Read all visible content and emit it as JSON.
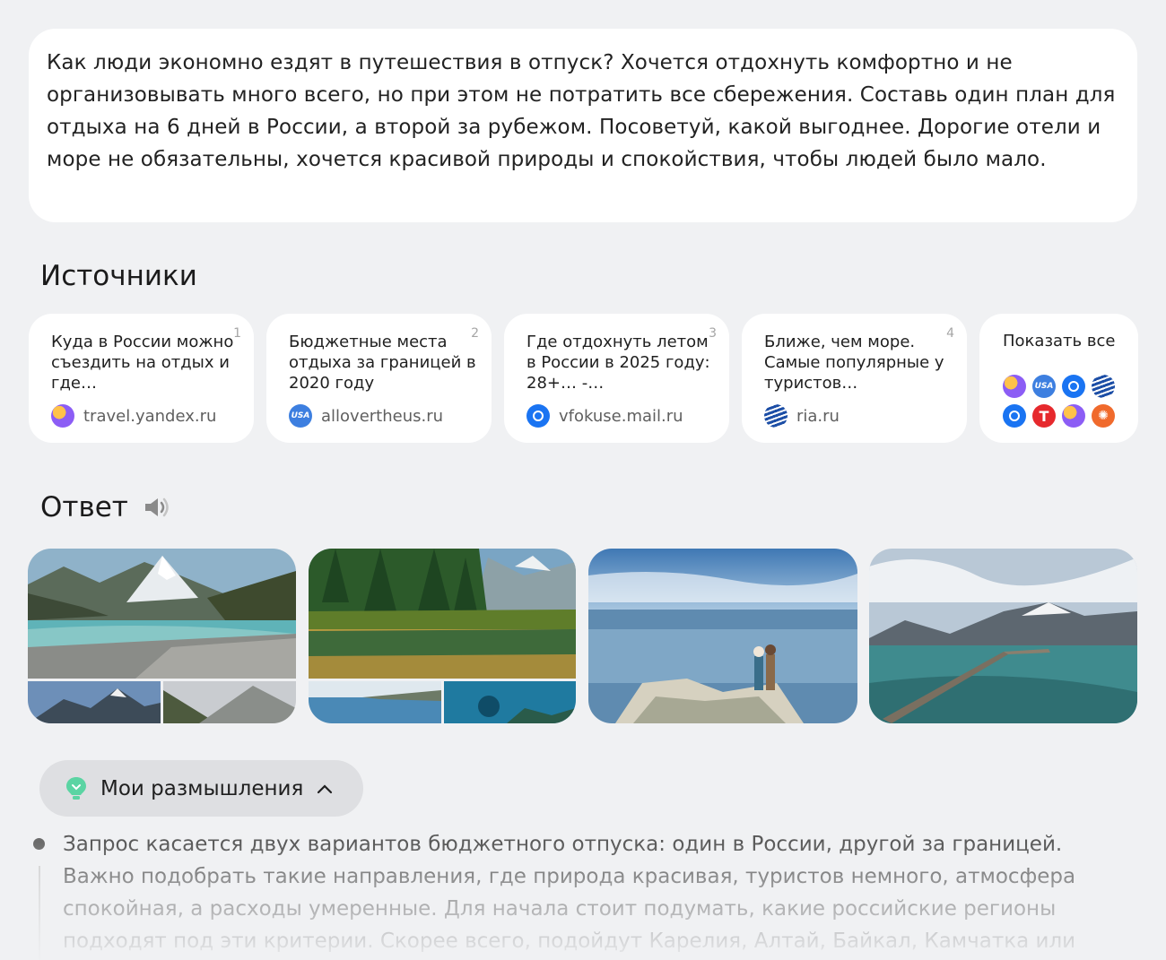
{
  "query": {
    "text": "Как люди экономно ездят в путешествия в отпуск? Хочется отдохнуть комфортно и не организовывать много всего, но при этом не потратить все сбережения. Составь один план для отдыха на 6 дней в России, а второй за рубежом. Посоветуй, какой выгоднее. Дорогие отели и море не обязательны, хочется красивой природы и спокойствия, чтобы людей было мало."
  },
  "sources": {
    "title": "Источники",
    "items": [
      {
        "num": "1",
        "title": "Куда в России можно съездить на отдых и где…",
        "domain": "travel.yandex.ru",
        "favicon": "yandex-travel-icon"
      },
      {
        "num": "2",
        "title": "Бюджетные места отдыха за границей в 2020 году",
        "domain": "allovertheus.ru",
        "favicon": "usa-icon"
      },
      {
        "num": "3",
        "title": "Где отдохнуть летом в России в 2025 году: 28+… -…",
        "domain": "vfokuse.mail.ru",
        "favicon": "mail-focus-icon"
      },
      {
        "num": "4",
        "title": "Ближе, чем море. Самые популярные у туристов…",
        "domain": "ria.ru",
        "favicon": "ria-icon"
      }
    ],
    "show_all_label": "Показать все",
    "show_all_icons": [
      "yandex-travel-icon",
      "usa-icon",
      "mail-focus-icon",
      "ria-icon",
      "mail-focus-icon",
      "t-journal-icon",
      "yandex-travel-icon",
      "palm-icon"
    ],
    "usa_badge": "USA",
    "t_badge": "T"
  },
  "answer": {
    "title": "Ответ",
    "speaker_icon": "speaker-icon"
  },
  "thinking": {
    "label": "Мои размышления",
    "icon": "lightbulb-icon",
    "chevron": "chevron-up-icon",
    "text": "Запрос касается двух вариантов бюджетного отпуска: один в России, другой за границей. Важно подобрать такие направления, где природа красивая, туристов немного, атмосфера спокойная, а расходы умеренные. Для начала стоит подумать, какие российские регионы подходят под эти критерии. Скорее всего, подойдут Карелия, Алтай, Байкал, Камчатка или"
  },
  "colors": {
    "background": "#f0f1f3",
    "card": "#ffffff",
    "thinking_pill": "#dedfe2"
  }
}
